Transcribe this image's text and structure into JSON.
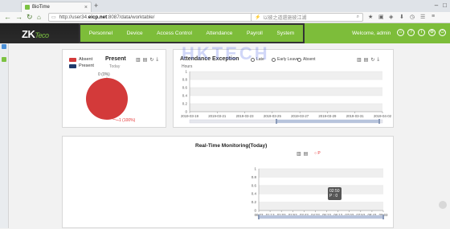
{
  "browser": {
    "tab_title": "BioTime",
    "url_prefix": "http://user34.",
    "url_host": "eicp.net",
    "url_rest": ":8087/data/worktable/",
    "search_placeholder": "以彼之道還施彼江湖"
  },
  "header": {
    "logo_main": "ZK",
    "logo_sub": "Teco",
    "menu": [
      "Personnel",
      "Device",
      "Access Control",
      "Attendance",
      "Payroll",
      "System"
    ],
    "welcome": "Welcome,",
    "user": "admin",
    "icons": [
      "home-icon",
      "help-icon",
      "info-icon",
      "settings-icon",
      "power-icon"
    ]
  },
  "present_panel": {
    "title": "Present",
    "subtitle": "Today",
    "legend": [
      {
        "label": "Absent",
        "color": "#d33a3a"
      },
      {
        "label": "Present",
        "color": "#1f3a6b"
      }
    ],
    "label_present": "0 (0%)",
    "label_absent": "1 (100%)"
  },
  "attendance_panel": {
    "title": "Attendance Exception",
    "unit": "Hours",
    "legend": [
      "Late",
      "Early Leave",
      "Absent"
    ]
  },
  "watermark": "HKTECH",
  "realtime_panel": {
    "title": "Real-Time Monitoring(Today)",
    "legend": "P",
    "tooltip_time": "02:50",
    "tooltip_value": "P : 0"
  },
  "chart_data": [
    {
      "type": "pie",
      "categories": [
        "Absent",
        "Present"
      ],
      "values": [
        1,
        0
      ],
      "colors": [
        "#d33a3a",
        "#1f3a6b"
      ]
    },
    {
      "type": "line",
      "title": "Attendance Exception",
      "ylabel": "Hours",
      "x": [
        "2019-03-19",
        "2019-03-21",
        "2019-03-23",
        "2019-03-25",
        "2019-03-27",
        "2019-03-29",
        "2019-03-31",
        "2019-04-02"
      ],
      "yticks": [
        0,
        0.2,
        0.4,
        0.6,
        0.8,
        1
      ],
      "ylim": [
        0,
        1
      ],
      "series": [
        {
          "name": "Late",
          "values": []
        },
        {
          "name": "Early Leave",
          "values": []
        },
        {
          "name": "Absent",
          "values": []
        }
      ]
    },
    {
      "type": "line",
      "title": "Real-Time Monitoring(Today)",
      "x": [
        "00:23",
        "01:13",
        "02:03",
        "02:53",
        "03:43",
        "04:33",
        "05:23",
        "06:13",
        "07:03",
        "07:53",
        "08:43",
        "09:03"
      ],
      "yticks": [
        0,
        0.2,
        0.4,
        0.6,
        0.8,
        1
      ],
      "ylim": [
        0,
        1
      ],
      "series": [
        {
          "name": "P",
          "values": []
        }
      ]
    }
  ]
}
